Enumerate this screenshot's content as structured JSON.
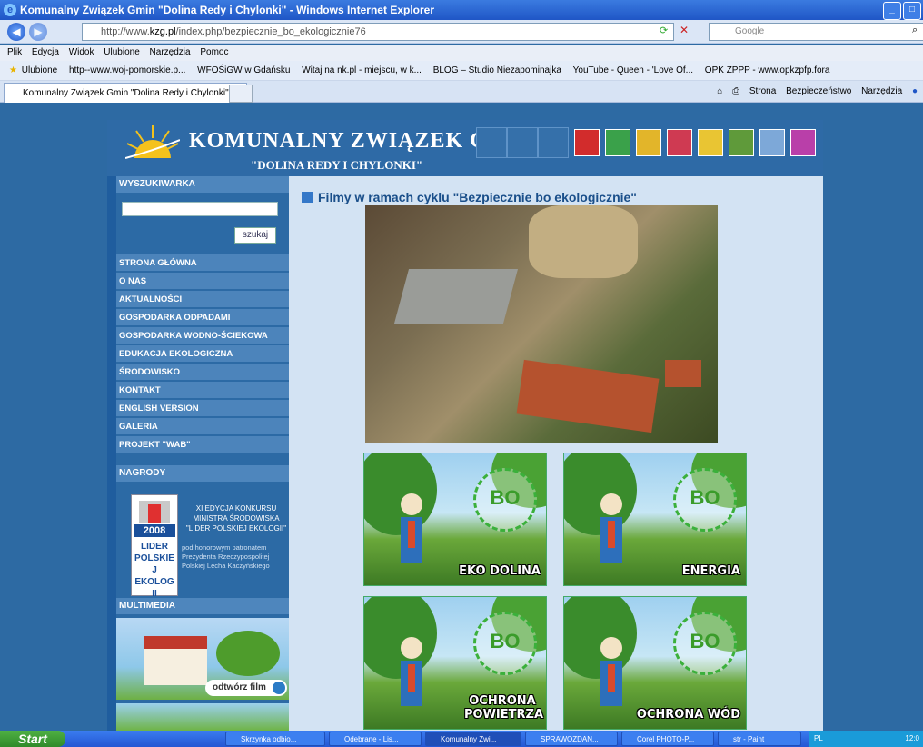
{
  "window": {
    "title": "Komunalny Związek Gmin \"Dolina Redy i Chylonki\" - Windows Internet Explorer"
  },
  "address": {
    "url_prefix": "http://www.",
    "url_domain": "kzg.pl",
    "url_rest": "/index.php/bezpiecznie_bo_ekologicznie76",
    "search_placeholder": "Google"
  },
  "menu": [
    "Plik",
    "Edycja",
    "Widok",
    "Ulubione",
    "Narzędzia",
    "Pomoc"
  ],
  "favorites": {
    "label": "Ulubione",
    "items": [
      "http--www.woj-pomorskie.p...",
      "WFOŚiGW w Gdańsku",
      "Witaj na nk.pl - miejscu, w k...",
      "BLOG – Studio Niezapominajka",
      "YouTube - Queen - 'Love Of...",
      "OPK ZPPP - www.opkzpfp.fora"
    ]
  },
  "tab": {
    "label": "Komunalny Związek Gmin \"Dolina Redy i Chylonki\""
  },
  "commands": [
    "Strona",
    "Bezpieczeństwo",
    "Narzędzia"
  ],
  "site": {
    "title": "KOMUNALNY ZWIĄZEK GMIN",
    "registered": "®",
    "subtitle": "\"DOLINA REDY I CHYLONKI\""
  },
  "sidebar": {
    "search_heading": "WYSZUKIWARKA",
    "search_button": "szukaj",
    "nav": [
      "STRONA GŁÓWNA",
      "O NAS",
      "AKTUALNOŚCI",
      "GOSPODARKA ODPADAMI",
      "GOSPODARKA WODNO-ŚCIEKOWA",
      "EDUKACJA EKOLOGICZNA",
      "ŚRODOWISKO",
      "KONTAKT",
      "ENGLISH VERSION",
      "GALERIA",
      "PROJEKT \"WAB\""
    ],
    "awards_heading": "NAGRODY",
    "award_year": "2008",
    "award_logo_text": "LIDER POLSKIEJ EKOLOGII",
    "award_title": "XI EDYCJA KONKURSU MINISTRA ŚRODOWISKA \"LIDER POLSKIEJ EKOLOGII\"",
    "award_note": "pod honorowym patronatem Prezydenta Rzeczypospolitej Polskiej Lecha Kaczyńskiego",
    "multimedia_heading": "MULTIMEDIA",
    "play_button": "odtwórz film"
  },
  "content": {
    "heading": "Filmy w ramach cyklu \"Bezpiecznie bo ekologicznie\"",
    "circle_text": "BO",
    "videos": [
      {
        "label": "EKO DOLINA"
      },
      {
        "label": "ENERGIA"
      },
      {
        "label": "OCHRONA POWIETRZA"
      },
      {
        "label": "OCHRONA WÓD"
      }
    ]
  },
  "taskbar": {
    "start": "Start",
    "items": [
      "Skrzynka odbio...",
      "Odebrane - Lis...",
      "Komunalny Zwi...",
      "SPRAWOZDAN...",
      "Corel PHOTO-P...",
      "str - Paint"
    ],
    "lang": "PL",
    "time": "12:0"
  }
}
